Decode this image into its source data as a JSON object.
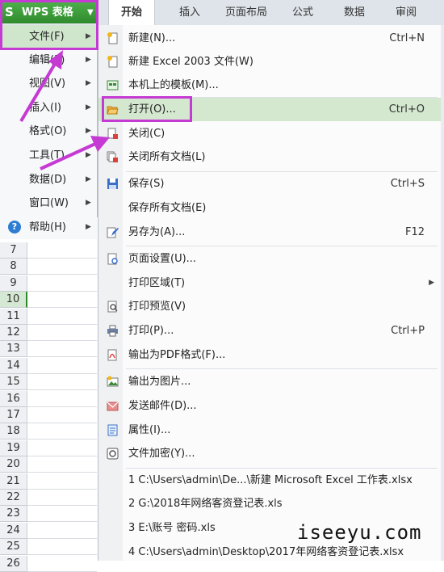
{
  "app": {
    "title": "WPS 表格"
  },
  "tabs": [
    "开始",
    "插入",
    "页面布局",
    "公式",
    "数据",
    "审阅"
  ],
  "grid": {
    "row_numbers": [
      "7",
      "8",
      "9",
      "10",
      "11",
      "12",
      "13",
      "14",
      "15",
      "16",
      "17",
      "18",
      "19",
      "20",
      "21",
      "22",
      "23",
      "24",
      "25",
      "26"
    ],
    "selected_row": "10"
  },
  "left_menu": {
    "items": [
      {
        "label": "文件(F)",
        "active": true
      },
      {
        "label": "编辑(E)"
      },
      {
        "label": "视图(V)"
      },
      {
        "label": "插入(I)"
      },
      {
        "label": "格式(O)"
      },
      {
        "label": "工具(T)"
      },
      {
        "label": "数据(D)"
      },
      {
        "label": "窗口(W)"
      },
      {
        "label": "帮助(H)",
        "icon": "help-icon"
      }
    ]
  },
  "file_menu": {
    "items": [
      {
        "label": "新建(N)...",
        "shortcut": "Ctrl+N",
        "icon": "new-document-icon"
      },
      {
        "label": "新建 Excel 2003 文件(W)",
        "icon": "new-excel-file-icon"
      },
      {
        "label": "本机上的模板(M)...",
        "icon": "template-icon"
      },
      {
        "label": "打开(O)...",
        "shortcut": "Ctrl+O",
        "icon": "open-folder-icon",
        "highlighted": true
      },
      {
        "label": "关闭(C)",
        "icon": "close-document-icon"
      },
      {
        "label": "关闭所有文档(L)",
        "icon": "close-all-documents-icon"
      },
      {
        "label": "保存(S)",
        "shortcut": "Ctrl+S",
        "icon": "save-icon"
      },
      {
        "label": "保存所有文档(E)"
      },
      {
        "label": "另存为(A)...",
        "shortcut": "F12",
        "icon": "save-as-icon"
      },
      {
        "label": "页面设置(U)...",
        "icon": "page-setup-icon"
      },
      {
        "label": "打印区域(T)",
        "submenu": true
      },
      {
        "label": "打印预览(V)",
        "icon": "print-preview-icon"
      },
      {
        "label": "打印(P)...",
        "shortcut": "Ctrl+P",
        "icon": "print-icon"
      },
      {
        "label": "输出为PDF格式(F)...",
        "icon": "pdf-export-icon"
      },
      {
        "label": "输出为图片...",
        "icon": "image-export-icon"
      },
      {
        "label": "发送邮件(D)...",
        "icon": "mail-icon"
      },
      {
        "label": "属性(I)...",
        "icon": "properties-icon"
      },
      {
        "label": "文件加密(Y)...",
        "icon": "encrypt-icon"
      }
    ],
    "recent_files": [
      "1 C:\\Users\\admin\\De...\\新建 Microsoft Excel 工作表.xlsx",
      "2 G:\\2018年网络客资登记表.xls",
      "3 E:\\账号 密码.xls",
      "4 C:\\Users\\admin\\Desktop\\2017年网络客资登记表.xlsx"
    ]
  },
  "watermark": "iseeyu.com",
  "colors": {
    "accent_green": "#2f8a2c",
    "highlight": "#d4e8d0",
    "annotation": "#c53ad3"
  }
}
